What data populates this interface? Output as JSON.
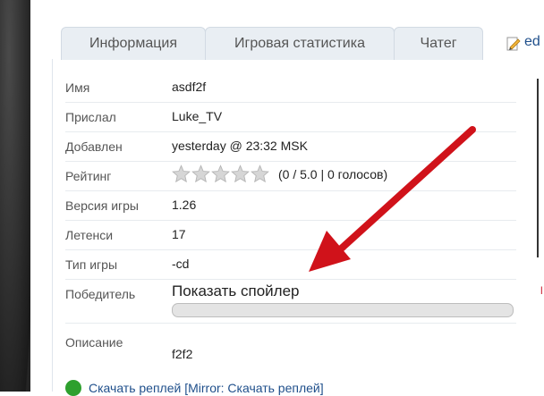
{
  "tabs": [
    {
      "label": "Информация"
    },
    {
      "label": "Игровая статистика"
    },
    {
      "label": "Чатег"
    }
  ],
  "edit_label": "ed",
  "rows": {
    "name": {
      "label": "Имя",
      "value": "asdf2f"
    },
    "sender": {
      "label": "Прислал",
      "value": "Luke_TV"
    },
    "added": {
      "label": "Добавлен",
      "value": "yesterday @ 23:32 MSK"
    },
    "rating": {
      "label": "Рейтинг",
      "value": "(0 / 5.0 | 0 голосов)",
      "stars_filled": 0,
      "stars_total": 5
    },
    "version": {
      "label": "Версия игры",
      "value": "1.26"
    },
    "latency": {
      "label": "Летенси",
      "value": "17"
    },
    "game_type": {
      "label": "Тип игры",
      "value": "-cd"
    },
    "winner": {
      "label": "Победитель",
      "value": "Показать спойлер"
    },
    "description": {
      "label": "Описание",
      "value": "f2f2"
    }
  },
  "download_text": "Скачать реплей [Mirror: Скачать реплей]",
  "colors": {
    "link": "#1f4f8b",
    "arrow": "#d0121a",
    "tab_bg": "#e9eef3"
  }
}
